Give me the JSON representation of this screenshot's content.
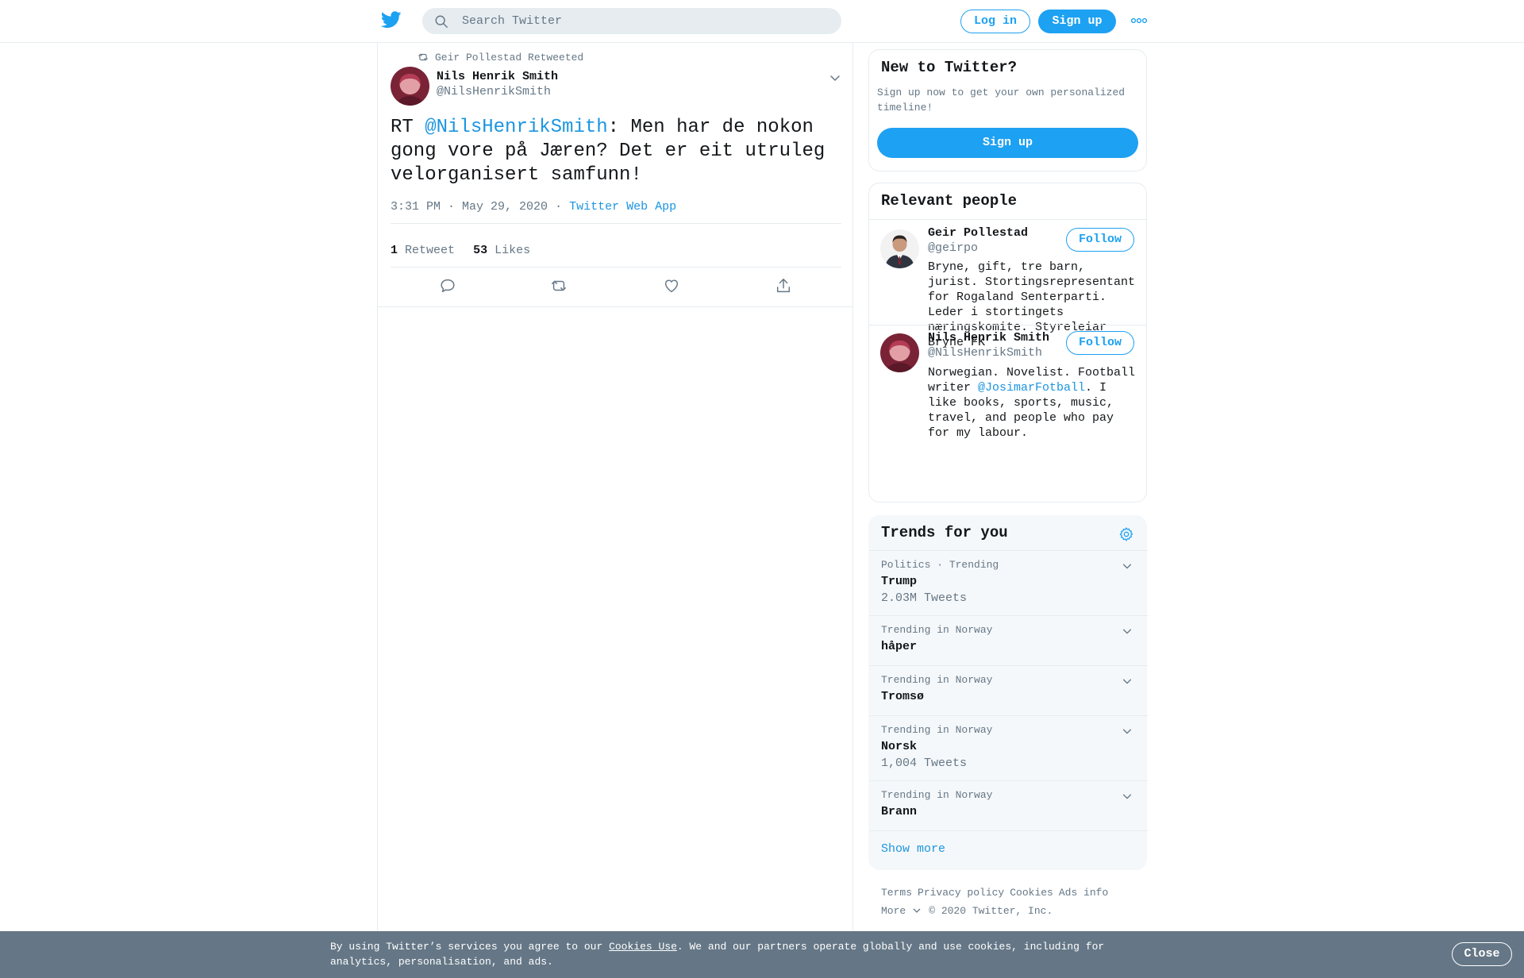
{
  "header": {
    "logo_icon": "twitter-bird-icon",
    "search_placeholder": "Search Twitter",
    "login_label": "Log in",
    "signup_label": "Sign up",
    "more_icon": "more-dots-icon"
  },
  "tweet": {
    "retweeted_by": "Geir Pollestad Retweeted",
    "author_name": "Nils Henrik Smith",
    "author_handle": "@NilsHenrikSmith",
    "text_prefix": "RT ",
    "text_mention": "@NilsHenrikSmith",
    "text_body": ": Men har de nokon gong vore på Jæren? Det er eit utruleg velorganisert samfunn!",
    "timestamp": "3:31 PM · May 29, 2020",
    "separator": "·",
    "source": "Twitter Web App",
    "retweet_count": "1",
    "retweet_label": "Retweet",
    "like_count": "53",
    "like_label": "Likes"
  },
  "sidebar": {
    "new_to_twitter": {
      "title": "New to Twitter?",
      "description": "Sign up now to get your own personalized timeline!",
      "signup_label": "Sign up"
    },
    "relevant_people": {
      "title": "Relevant people",
      "people": [
        {
          "name": "Geir Pollestad",
          "handle": "@geirpo",
          "bio": "Bryne, gift, tre barn, jurist. Stortingsrepresentant for Rogaland Senterparti. Leder i stortingets næringskomite. Styreleiar Bryne FK",
          "follow_label": "Follow"
        },
        {
          "name": "Nils Henrik Smith",
          "handle": "@NilsHenrikSmith",
          "bio_prefix": "Norwegian. Novelist. Football writer ",
          "bio_link": "@JosimarFotball",
          "bio_suffix": ". I like books, sports, music, travel, and people who pay for my labour.",
          "follow_label": "Follow"
        }
      ]
    },
    "trends": {
      "title": "Trends for you",
      "items": [
        {
          "category": "Politics · Trending",
          "name": "Trump",
          "count": "2.03M Tweets"
        },
        {
          "category": "Trending in Norway",
          "name": "håper",
          "count": ""
        },
        {
          "category": "Trending in Norway",
          "name": "Tromsø",
          "count": ""
        },
        {
          "category": "Trending in Norway",
          "name": "Norsk",
          "count": "1,004 Tweets"
        },
        {
          "category": "Trending in Norway",
          "name": "Brann",
          "count": ""
        }
      ],
      "show_more": "Show more"
    },
    "footer": {
      "links": [
        "Terms",
        "Privacy policy",
        "Cookies",
        "Ads info"
      ],
      "more_label": "More",
      "copyright": "© 2020 Twitter, Inc."
    }
  },
  "cookie_bar": {
    "text_before": "By using Twitter’s services you agree to our ",
    "link": "Cookies Use",
    "text_after": ". We and our partners operate globally and use cookies, including for analytics, personalisation, and ads.",
    "close_label": "Close"
  },
  "colors": {
    "brand": "#1da1f2",
    "link": "#1b95e0",
    "muted": "#657786",
    "cookie_bg": "#657786"
  }
}
